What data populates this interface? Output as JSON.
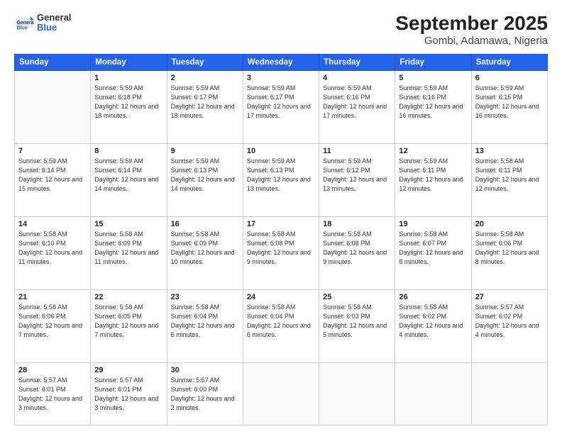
{
  "header": {
    "logo": {
      "general": "General",
      "blue": "Blue"
    },
    "title": "September 2025",
    "subtitle": "Gombi, Adamawa, Nigeria"
  },
  "weekdays": [
    "Sunday",
    "Monday",
    "Tuesday",
    "Wednesday",
    "Thursday",
    "Friday",
    "Saturday"
  ],
  "weeks": [
    [
      null,
      {
        "day": 1,
        "sunrise": "5:59 AM",
        "sunset": "6:18 PM",
        "daylight": "12 hours and 18 minutes."
      },
      {
        "day": 2,
        "sunrise": "5:59 AM",
        "sunset": "6:17 PM",
        "daylight": "12 hours and 18 minutes."
      },
      {
        "day": 3,
        "sunrise": "5:59 AM",
        "sunset": "6:17 PM",
        "daylight": "12 hours and 17 minutes."
      },
      {
        "day": 4,
        "sunrise": "5:59 AM",
        "sunset": "6:16 PM",
        "daylight": "12 hours and 17 minutes."
      },
      {
        "day": 5,
        "sunrise": "5:59 AM",
        "sunset": "6:16 PM",
        "daylight": "12 hours and 16 minutes."
      },
      {
        "day": 6,
        "sunrise": "5:59 AM",
        "sunset": "6:15 PM",
        "daylight": "12 hours and 16 minutes."
      }
    ],
    [
      {
        "day": 7,
        "sunrise": "5:59 AM",
        "sunset": "6:14 PM",
        "daylight": "12 hours and 15 minutes."
      },
      {
        "day": 8,
        "sunrise": "5:59 AM",
        "sunset": "6:14 PM",
        "daylight": "12 hours and 14 minutes."
      },
      {
        "day": 9,
        "sunrise": "5:59 AM",
        "sunset": "6:13 PM",
        "daylight": "12 hours and 14 minutes."
      },
      {
        "day": 10,
        "sunrise": "5:59 AM",
        "sunset": "6:13 PM",
        "daylight": "12 hours and 13 minutes."
      },
      {
        "day": 11,
        "sunrise": "5:59 AM",
        "sunset": "6:12 PM",
        "daylight": "12 hours and 13 minutes."
      },
      {
        "day": 12,
        "sunrise": "5:59 AM",
        "sunset": "6:11 PM",
        "daylight": "12 hours and 12 minutes."
      },
      {
        "day": 13,
        "sunrise": "5:58 AM",
        "sunset": "6:11 PM",
        "daylight": "12 hours and 12 minutes."
      }
    ],
    [
      {
        "day": 14,
        "sunrise": "5:58 AM",
        "sunset": "6:10 PM",
        "daylight": "12 hours and 11 minutes."
      },
      {
        "day": 15,
        "sunrise": "5:58 AM",
        "sunset": "6:09 PM",
        "daylight": "12 hours and 11 minutes."
      },
      {
        "day": 16,
        "sunrise": "5:58 AM",
        "sunset": "6:09 PM",
        "daylight": "12 hours and 10 minutes."
      },
      {
        "day": 17,
        "sunrise": "5:58 AM",
        "sunset": "6:08 PM",
        "daylight": "12 hours and 9 minutes."
      },
      {
        "day": 18,
        "sunrise": "5:58 AM",
        "sunset": "6:08 PM",
        "daylight": "12 hours and 9 minutes."
      },
      {
        "day": 19,
        "sunrise": "5:58 AM",
        "sunset": "6:07 PM",
        "daylight": "12 hours and 8 minutes."
      },
      {
        "day": 20,
        "sunrise": "5:58 AM",
        "sunset": "6:06 PM",
        "daylight": "12 hours and 8 minutes."
      }
    ],
    [
      {
        "day": 21,
        "sunrise": "5:58 AM",
        "sunset": "6:06 PM",
        "daylight": "12 hours and 7 minutes."
      },
      {
        "day": 22,
        "sunrise": "5:58 AM",
        "sunset": "6:05 PM",
        "daylight": "12 hours and 7 minutes."
      },
      {
        "day": 23,
        "sunrise": "5:58 AM",
        "sunset": "6:04 PM",
        "daylight": "12 hours and 6 minutes."
      },
      {
        "day": 24,
        "sunrise": "5:58 AM",
        "sunset": "6:04 PM",
        "daylight": "12 hours and 6 minutes."
      },
      {
        "day": 25,
        "sunrise": "5:58 AM",
        "sunset": "6:03 PM",
        "daylight": "12 hours and 5 minutes."
      },
      {
        "day": 26,
        "sunrise": "5:58 AM",
        "sunset": "6:02 PM",
        "daylight": "12 hours and 4 minutes."
      },
      {
        "day": 27,
        "sunrise": "5:57 AM",
        "sunset": "6:02 PM",
        "daylight": "12 hours and 4 minutes."
      }
    ],
    [
      {
        "day": 28,
        "sunrise": "5:57 AM",
        "sunset": "6:01 PM",
        "daylight": "12 hours and 3 minutes."
      },
      {
        "day": 29,
        "sunrise": "5:57 AM",
        "sunset": "6:01 PM",
        "daylight": "12 hours and 3 minutes."
      },
      {
        "day": 30,
        "sunrise": "5:57 AM",
        "sunset": "6:00 PM",
        "daylight": "12 hours and 2 minutes."
      },
      null,
      null,
      null,
      null
    ]
  ]
}
